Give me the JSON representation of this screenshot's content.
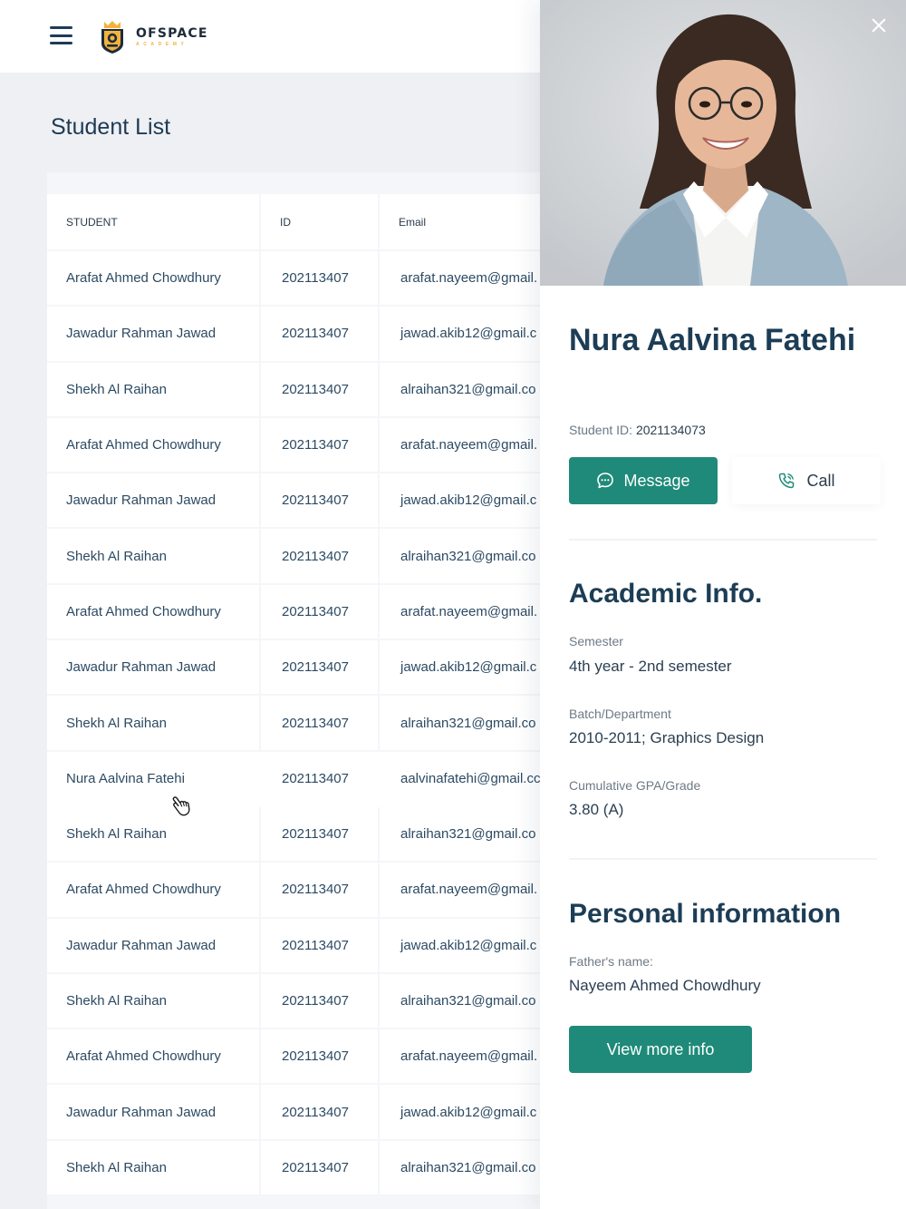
{
  "header": {
    "menu_icon": "hamburger-menu-icon",
    "logo_name": "OFSPACE",
    "logo_sub": "ACADEMY",
    "logo_icon": "shield-crown-logo",
    "brand_color": "#f2b33d"
  },
  "page": {
    "title": "Student List"
  },
  "table": {
    "columns": [
      "STUDENT",
      "ID",
      "Email"
    ],
    "rows": [
      [
        "Arafat Ahmed Chowdhury",
        "202113407",
        "arafat.nayeem@gmail."
      ],
      [
        "Jawadur Rahman Jawad",
        "202113407",
        "jawad.akib12@gmail.c"
      ],
      [
        "Shekh Al Raihan",
        "202113407",
        "alraihan321@gmail.co"
      ],
      [
        "Arafat Ahmed Chowdhury",
        "202113407",
        "arafat.nayeem@gmail."
      ],
      [
        "Jawadur Rahman Jawad",
        "202113407",
        "jawad.akib12@gmail.c"
      ],
      [
        "Shekh Al Raihan",
        "202113407",
        "alraihan321@gmail.co"
      ],
      [
        "Arafat Ahmed Chowdhury",
        "202113407",
        "arafat.nayeem@gmail."
      ],
      [
        "Jawadur Rahman Jawad",
        "202113407",
        "jawad.akib12@gmail.c"
      ],
      [
        "Shekh Al Raihan",
        "202113407",
        "alraihan321@gmail.co"
      ],
      [
        "Nura Aalvina Fatehi",
        "202113407",
        "aalvinafatehi@gmail.cc"
      ],
      [
        "Shekh Al Raihan",
        "202113407",
        "alraihan321@gmail.co"
      ],
      [
        "Arafat Ahmed Chowdhury",
        "202113407",
        "arafat.nayeem@gmail."
      ],
      [
        "Jawadur Rahman Jawad",
        "202113407",
        "jawad.akib12@gmail.c"
      ],
      [
        "Shekh Al Raihan",
        "202113407",
        "alraihan321@gmail.co"
      ],
      [
        "Arafat Ahmed Chowdhury",
        "202113407",
        "arafat.nayeem@gmail."
      ],
      [
        "Jawadur Rahman Jawad",
        "202113407",
        "jawad.akib12@gmail.c"
      ],
      [
        "Shekh Al Raihan",
        "202113407",
        "alraihan321@gmail.co"
      ]
    ],
    "highlighted_row": 9
  },
  "profile": {
    "close_icon": "close-icon",
    "name": "Nura Aalvina Fatehi",
    "student_id_label": "Student ID:",
    "student_id": "2021134073",
    "message_label": "Message",
    "message_icon": "chat-bubble-icon",
    "call_label": "Call",
    "call_icon": "phone-icon",
    "accent_color": "#1f8a79",
    "academic": {
      "title": "Academic Info.",
      "semester_label": "Semester",
      "semester": "4th year - 2nd semester",
      "batch_label": "Batch/Department",
      "batch": "2010-2011; Graphics Design",
      "gpa_label": "Cumulative GPA/Grade",
      "gpa": "3.80 (A)"
    },
    "personal": {
      "title": "Personal information",
      "father_label": "Father's name:",
      "father": "Nayeem Ahmed Chowdhury"
    },
    "more_label": "View more info"
  }
}
